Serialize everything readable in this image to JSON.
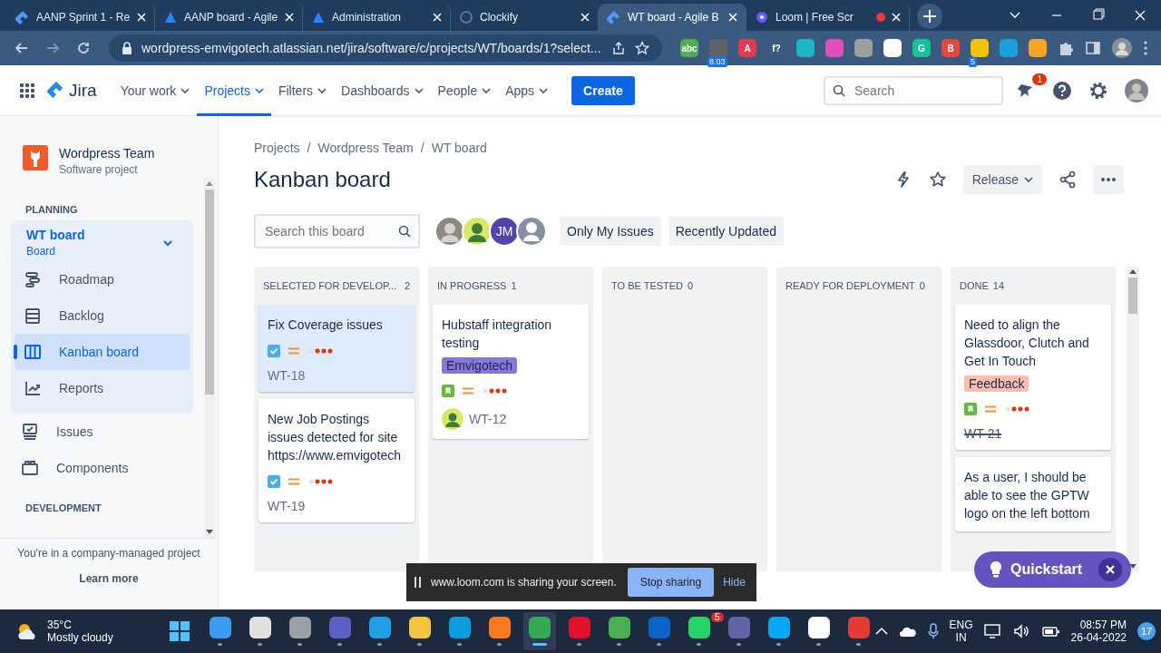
{
  "browser": {
    "tabs": [
      {
        "title": "AANP Sprint 1 - Re",
        "kind": "jira",
        "selected": false,
        "recording": false
      },
      {
        "title": "AANP board - Agile",
        "kind": "atlassian",
        "selected": false,
        "recording": false
      },
      {
        "title": "Administration",
        "kind": "atlassian",
        "selected": false,
        "recording": false
      },
      {
        "title": "Clockify",
        "kind": "clockify",
        "selected": false,
        "recording": false
      },
      {
        "title": "WT board - Agile B",
        "kind": "jira",
        "selected": true,
        "recording": false
      },
      {
        "title": "Loom | Free Scr",
        "kind": "loom",
        "selected": false,
        "recording": true
      }
    ],
    "url": "wordpress-emvigotech.atlassian.net/jira/software/c/projects/WT/boards/1?select...",
    "extensions": [
      {
        "color": "#4caf50",
        "label": "abc"
      },
      {
        "color": "#5f6368",
        "badge": "8.03"
      },
      {
        "color": "#e53950",
        "label": "A"
      },
      {
        "color": "#3a5a80",
        "label": "f?"
      },
      {
        "color": "#1fb5c9"
      },
      {
        "color": "#e24dbb"
      },
      {
        "color": "#9e9e9e"
      },
      {
        "color": "#ffffff"
      },
      {
        "color": "#15c39a",
        "label": "G"
      },
      {
        "color": "#e8473f",
        "label": "B"
      },
      {
        "color": "#f4c20d",
        "badge": "5"
      },
      {
        "color": "#1a9fe0"
      },
      {
        "color": "#f7a325"
      }
    ]
  },
  "nav": {
    "logo": "Jira",
    "items": [
      {
        "label": "Your work",
        "selected": false
      },
      {
        "label": "Projects",
        "selected": true
      },
      {
        "label": "Filters",
        "selected": false
      },
      {
        "label": "Dashboards",
        "selected": false
      },
      {
        "label": "People",
        "selected": false
      },
      {
        "label": "Apps",
        "selected": false
      }
    ],
    "create": "Create",
    "search_placeholder": "Search",
    "notification_count": "1"
  },
  "sidebar": {
    "project": "Wordpress Team",
    "project_type": "Software project",
    "planning": "PLANNING",
    "board": {
      "title": "WT board",
      "subtitle": "Board",
      "expanded": true,
      "items": [
        {
          "label": "Roadmap",
          "kind": "roadmap",
          "selected": false
        },
        {
          "label": "Backlog",
          "kind": "backlog",
          "selected": false
        },
        {
          "label": "Kanban board",
          "kind": "board",
          "selected": true
        },
        {
          "label": "Reports",
          "kind": "reports",
          "selected": false
        }
      ]
    },
    "items": [
      {
        "label": "Issues",
        "kind": "issues"
      },
      {
        "label": "Components",
        "kind": "components"
      }
    ],
    "development": "DEVELOPMENT",
    "footer": "You're in a company-managed project",
    "learn_more": "Learn more"
  },
  "board": {
    "breadcrumbs": [
      {
        "text": "Projects",
        "separator": "/"
      },
      {
        "text": "Wordpress Team",
        "separator": "/"
      },
      {
        "text": "WT board"
      }
    ],
    "title": "Kanban board",
    "release": "Release",
    "search_placeholder": "Search this board",
    "avatars": [
      {
        "kind": "photo"
      },
      {
        "kind": "photo"
      },
      {
        "kind": "initials",
        "text": "JM"
      },
      {
        "kind": "default"
      }
    ],
    "filters": [
      "Only My Issues",
      "Recently Updated"
    ],
    "columns": [
      {
        "title": "SELECTED FOR DEVELOP...",
        "count": "2",
        "cards": [
          {
            "summary": "Fix Coverage issues",
            "kind": "task",
            "key": "WT-18",
            "selected": true,
            "done": false,
            "assignee": false
          },
          {
            "summary": "New Job Postings issues detected for site https://www.emvigotech",
            "kind": "task",
            "key": "WT-19",
            "selected": false,
            "done": false,
            "assignee": false
          }
        ]
      },
      {
        "title": "IN PROGRESS",
        "count": "1",
        "cards": [
          {
            "summary": "Hubstaff integration testing",
            "kind": "story",
            "tag": {
              "label": "Emvigotech",
              "color": "#8777d9"
            },
            "key": "WT-12",
            "selected": false,
            "done": false,
            "assignee": true
          }
        ]
      },
      {
        "title": "TO BE TESTED",
        "count": "0"
      },
      {
        "title": "READY FOR DEPLOYMENT",
        "count": "0"
      },
      {
        "title": "DONE",
        "count": "14",
        "cards": [
          {
            "summary": "Need to align the Glassdoor, Clutch and Get In Touch",
            "kind": "story",
            "tag": {
              "label": "Feedback",
              "color": "#ffbdad"
            },
            "key": "WT-21",
            "selected": false,
            "done": true,
            "assignee": false
          },
          {
            "summary": "As a user, I should be able to see the GPTW logo on the left bottom",
            "selected": false
          }
        ]
      }
    ]
  },
  "quickstart": "Quickstart",
  "loom": {
    "message": "www.loom.com is sharing your screen.",
    "stop": "Stop sharing",
    "hide": "Hide"
  },
  "taskbar": {
    "temperature": "35°C",
    "weather": "Mostly cloudy",
    "apps": [
      {
        "color": "#3a9bf0",
        "active": false
      },
      {
        "color": "#e0e0e0",
        "active": false
      },
      {
        "color": "#9aa0a6",
        "active": false
      },
      {
        "color": "#5b5fc7",
        "active": false
      },
      {
        "color": "#1fa0e6",
        "active": false
      },
      {
        "color": "#f5c542",
        "active": false
      },
      {
        "color": "#0a9ee0",
        "active": false
      },
      {
        "color": "#ff7a1f",
        "active": false
      },
      {
        "color": "#34a853",
        "active": true
      },
      {
        "color": "#e3102c",
        "active": false
      },
      {
        "color": "#4caf50",
        "active": false
      },
      {
        "color": "#0a64c8",
        "active": false
      },
      {
        "color": "#25d366",
        "active": false,
        "badge": "5"
      },
      {
        "color": "#6264a7",
        "active": false
      },
      {
        "color": "#03a9f4",
        "active": false
      },
      {
        "color": "#ffffff",
        "active": false
      },
      {
        "color": "#e53935",
        "active": false
      }
    ],
    "language": "ENG",
    "region": "IN",
    "time": "08:57 PM",
    "date": "26-04-2022",
    "notifications": "17"
  }
}
